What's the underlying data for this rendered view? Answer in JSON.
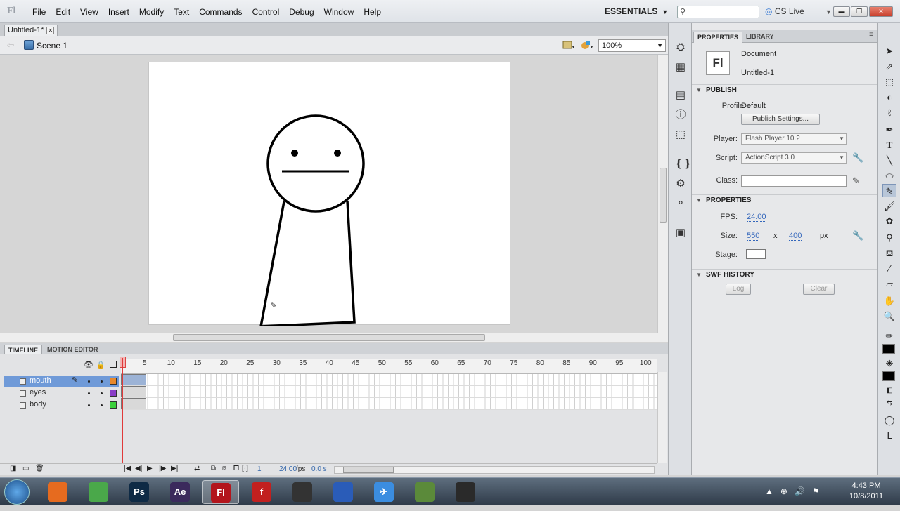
{
  "menubar": {
    "logo": "Fl",
    "items": [
      "File",
      "Edit",
      "View",
      "Insert",
      "Modify",
      "Text",
      "Commands",
      "Control",
      "Debug",
      "Window",
      "Help"
    ],
    "workspace": "ESSENTIALS",
    "search_placeholder": "",
    "cslive": "CS Live"
  },
  "document": {
    "tab_label": "Untitled-1*",
    "scene": "Scene 1",
    "zoom": "100%"
  },
  "timeline": {
    "tabs": [
      "TIMELINE",
      "MOTION EDITOR"
    ],
    "ruler_ticks": [
      "1",
      "5",
      "10",
      "15",
      "20",
      "25",
      "30",
      "35",
      "40",
      "45",
      "50",
      "55",
      "60",
      "65",
      "70",
      "75",
      "80",
      "85",
      "90",
      "95",
      "100"
    ],
    "layers": [
      {
        "name": "mouth",
        "color": "#e8882a",
        "selected": true
      },
      {
        "name": "eyes",
        "color": "#8a3dc8",
        "selected": false
      },
      {
        "name": "body",
        "color": "#3ccf3c",
        "selected": false
      }
    ],
    "footer": {
      "current_frame": "1",
      "fps": "24.00",
      "fps_unit": "fps",
      "time": "0.0 s"
    }
  },
  "properties": {
    "tabs": [
      "PROPERTIES",
      "LIBRARY"
    ],
    "doc_icon": "Fl",
    "doc_type": "Document",
    "doc_name": "Untitled-1",
    "publish": {
      "header": "PUBLISH",
      "profile_label": "Profile:",
      "profile_value": "Default",
      "settings_button": "Publish Settings...",
      "player_label": "Player:",
      "player_value": "Flash Player 10.2",
      "script_label": "Script:",
      "script_value": "ActionScript 3.0",
      "class_label": "Class:",
      "class_value": ""
    },
    "props": {
      "header": "PROPERTIES",
      "fps_label": "FPS:",
      "fps_value": "24.00",
      "size_label": "Size:",
      "width": "550",
      "x": "x",
      "height": "400",
      "unit": "px",
      "stage_label": "Stage:",
      "stage_color": "#ffffff"
    },
    "swf": {
      "header": "SWF HISTORY",
      "log_button": "Log",
      "clear_button": "Clear"
    }
  },
  "taskbar": {
    "apps": [
      {
        "name": "firefox-icon",
        "glyph": ""
      },
      {
        "name": "chrome-icon",
        "glyph": ""
      },
      {
        "name": "photoshop-icon",
        "glyph": "Ps"
      },
      {
        "name": "after-effects-icon",
        "glyph": "Ae"
      },
      {
        "name": "flash-icon",
        "glyph": "Fl"
      },
      {
        "name": "flash-player-icon",
        "glyph": "f"
      },
      {
        "name": "monitor-icon",
        "glyph": ""
      },
      {
        "name": "globe-icon",
        "glyph": ""
      },
      {
        "name": "airplane-icon",
        "glyph": "✈"
      },
      {
        "name": "minecraft-icon",
        "glyph": ""
      },
      {
        "name": "camera-icon",
        "glyph": ""
      }
    ],
    "time": "4:43 PM",
    "date": "10/8/2011"
  }
}
